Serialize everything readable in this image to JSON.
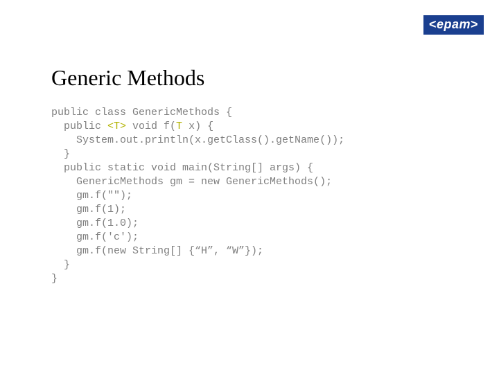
{
  "logo": {
    "open": "<",
    "name": "epam",
    "close": ">"
  },
  "title": "Generic Methods",
  "code": {
    "l01": "public class GenericMethods {",
    "l02a": "  public ",
    "l02b": "<T>",
    "l02c": " void f(",
    "l02d": "T",
    "l02e": " x) {",
    "l03": "    System.out.println(x.getClass().getName());",
    "l04": "  }",
    "l05": "  public static void main(String[] args) {",
    "l06": "    GenericMethods gm = new GenericMethods();",
    "l07": "    gm.f(\"\");",
    "l08": "    gm.f(1);",
    "l09": "    gm.f(1.0);",
    "l10": "    gm.f('c');",
    "l11": "    gm.f(new String[] {“H”, “W”});",
    "l12": "  }",
    "l13": "}"
  }
}
